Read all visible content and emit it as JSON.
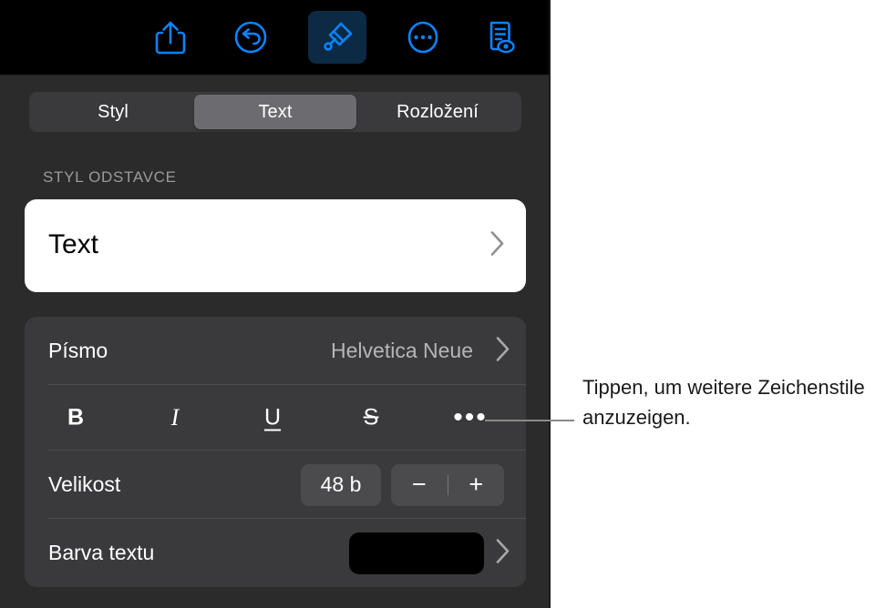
{
  "toolbar": {
    "items": [
      {
        "name": "share-icon",
        "label": "Share",
        "active": false
      },
      {
        "name": "undo-icon",
        "label": "Undo",
        "active": false
      },
      {
        "name": "format-brush-icon",
        "label": "Format",
        "active": true
      },
      {
        "name": "more-options-icon",
        "label": "More",
        "active": false
      },
      {
        "name": "document-view-icon",
        "label": "Document Options",
        "active": false
      }
    ],
    "accent_color": "#0a84ff",
    "active_background": "#0d2a45"
  },
  "tabs": [
    {
      "label": "Styl",
      "selected": false
    },
    {
      "label": "Text",
      "selected": true
    },
    {
      "label": "Rozložení",
      "selected": false
    }
  ],
  "paragraph_style": {
    "section_label": "STYL ODSTAVCE",
    "value": "Text",
    "chevron": "›"
  },
  "font": {
    "label": "Písmo",
    "value": "Helvetica Neue",
    "chevron": "›"
  },
  "character_styles": [
    {
      "name": "bold-button",
      "label": "B"
    },
    {
      "name": "italic-button",
      "label": "I"
    },
    {
      "name": "underline-button",
      "label": "U"
    },
    {
      "name": "strikethrough-button",
      "label": "S"
    },
    {
      "name": "more-character-styles-button",
      "label": "•••"
    }
  ],
  "size": {
    "label": "Velikost",
    "value": "48 b",
    "decrement": "−",
    "increment": "+"
  },
  "text_color": {
    "label": "Barva textu",
    "swatch_color": "#000000",
    "chevron": "›"
  },
  "callout": {
    "text": "Tippen, um weitere Zeichenstile anzuzeigen.",
    "line_color": "#8a8a8a"
  },
  "colors": {
    "panel_background": "#2b2b2b",
    "card_background": "#3a3a3c",
    "toolbar_background": "#000000",
    "selected_tab": "#6c6c70",
    "control_background": "#4b4b4d",
    "section_label_color": "#9b9b9e",
    "value_text_color": "#b6b6b8"
  }
}
